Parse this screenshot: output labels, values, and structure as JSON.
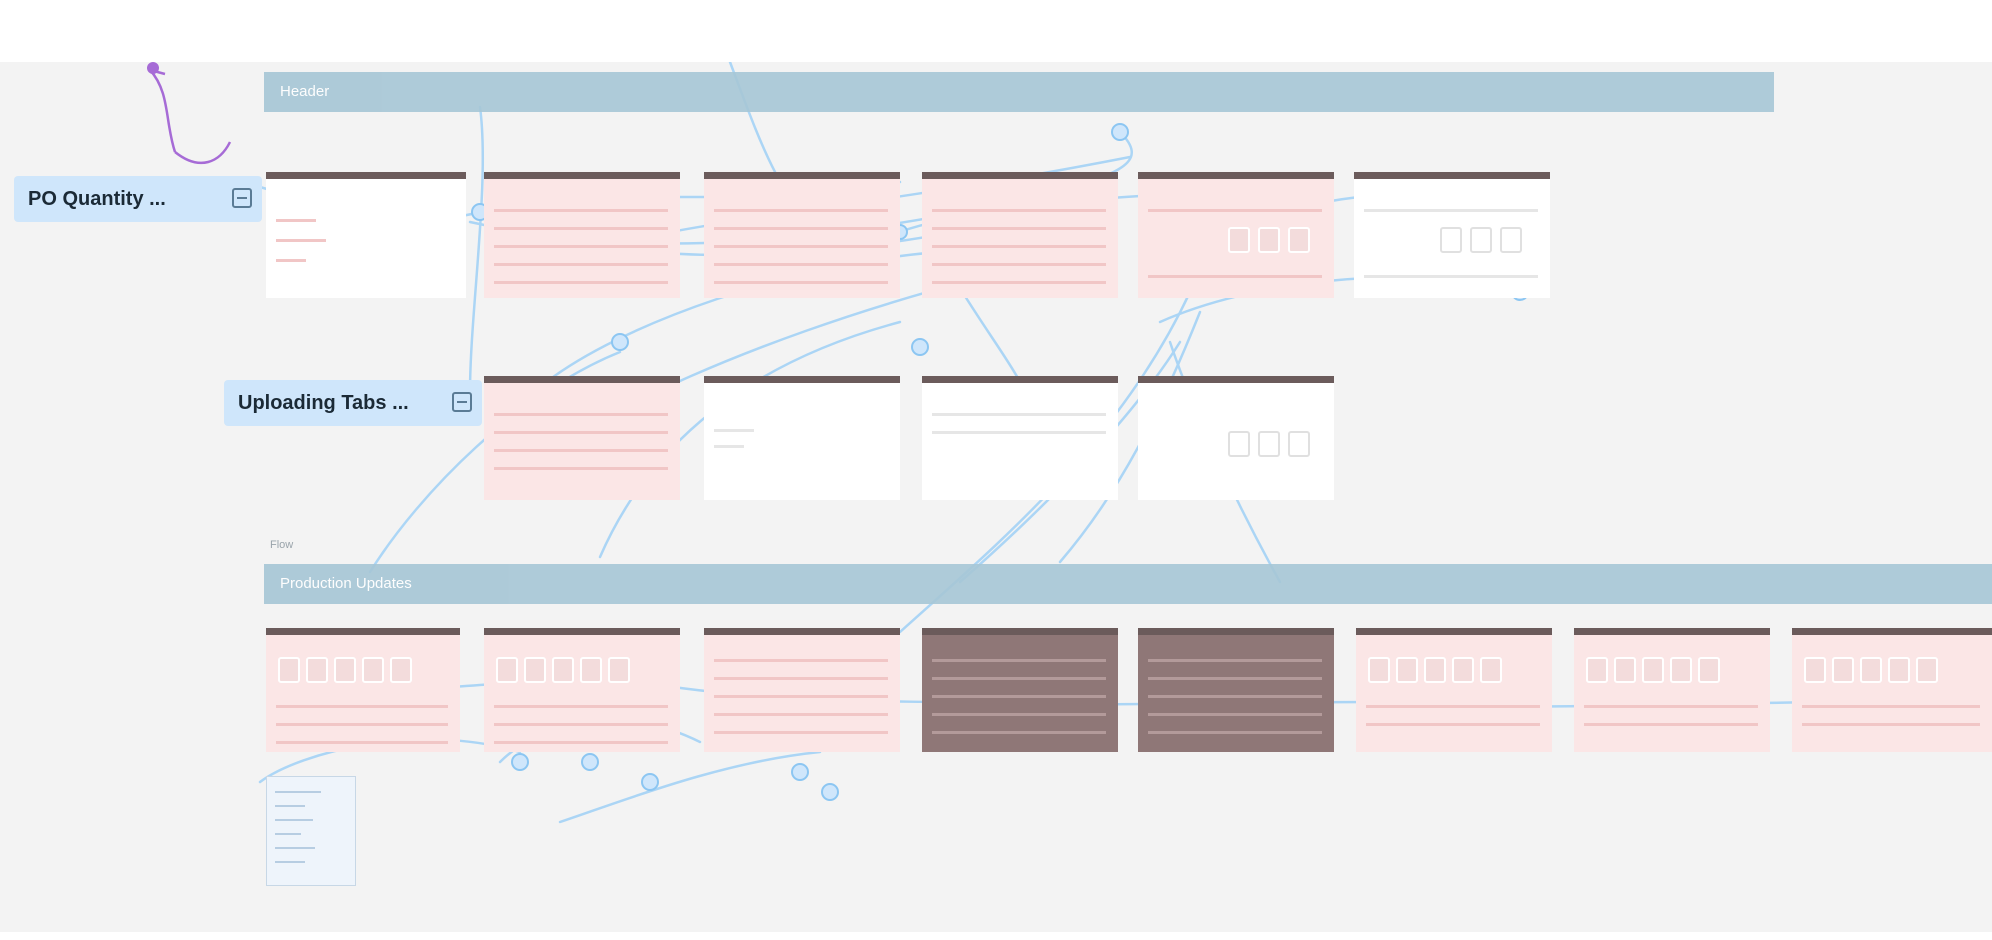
{
  "canvas": {
    "rows": [
      {
        "label": "PO Quantity ..."
      },
      {
        "label": "Uploading Tabs ..."
      }
    ],
    "sections": [
      {
        "title": "Header"
      },
      {
        "title": "Production Updates"
      }
    ],
    "note": "Flow",
    "colors": {
      "background": "#f3f3f3",
      "section_bar": "#a6c6d6",
      "row_label": "#cfe6fb",
      "card_pink": "#fbe6e6",
      "card_dark": "#8f7777",
      "card_header": "#6b5b5b",
      "connector": "#8cc6f2",
      "accent_purple": "#a66bd6"
    }
  }
}
